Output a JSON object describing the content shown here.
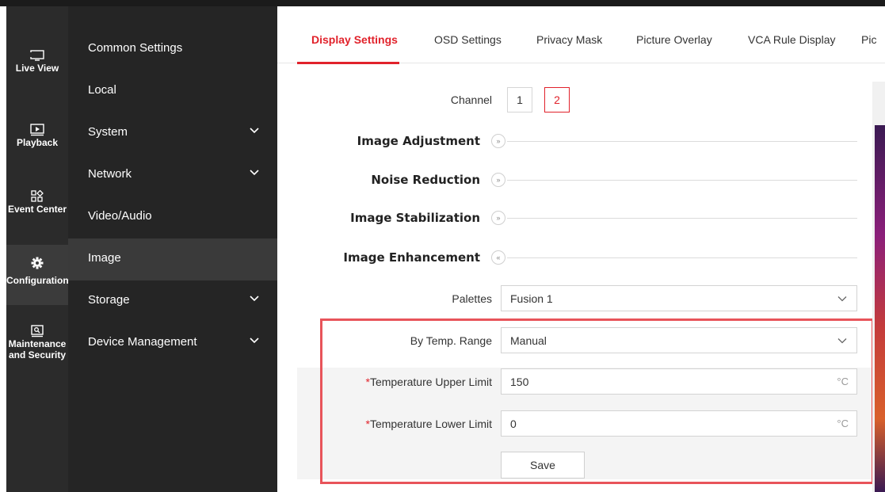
{
  "nav": {
    "items": [
      {
        "label": "Live View",
        "icon": "live-view-icon"
      },
      {
        "label": "Playback",
        "icon": "playback-icon"
      },
      {
        "label": "Event Center",
        "icon": "event-center-icon"
      },
      {
        "label": "Configuration",
        "icon": "gear-icon",
        "active": true
      },
      {
        "label": "Maintenance\nand Security",
        "icon": "maintenance-icon"
      }
    ]
  },
  "menu": {
    "items": [
      {
        "label": "Common Settings",
        "chevron": false
      },
      {
        "label": "Local",
        "chevron": false
      },
      {
        "label": "System",
        "chevron": true
      },
      {
        "label": "Network",
        "chevron": true
      },
      {
        "label": "Video/Audio",
        "chevron": false
      },
      {
        "label": "Image",
        "chevron": false,
        "active": true
      },
      {
        "label": "Storage",
        "chevron": true
      },
      {
        "label": "Device Management",
        "chevron": true
      }
    ]
  },
  "tabs": [
    {
      "label": "Display Settings",
      "active": true
    },
    {
      "label": "OSD Settings"
    },
    {
      "label": "Privacy Mask"
    },
    {
      "label": "Picture Overlay"
    },
    {
      "label": "VCA Rule Display"
    },
    {
      "label": "Pic"
    }
  ],
  "channel": {
    "label": "Channel",
    "options": [
      "1",
      "2"
    ],
    "selected": "2"
  },
  "sections": {
    "image_adjustment": "Image Adjustment",
    "noise_reduction": "Noise Reduction",
    "image_stabilization": "Image Stabilization",
    "image_enhancement": "Image Enhancement"
  },
  "form": {
    "palettes_label": "Palettes",
    "palettes_value": "Fusion 1",
    "temp_range_label": "By Temp. Range",
    "temp_range_value": "Manual",
    "required_mark": "*",
    "upper_label": "Temperature Upper Limit",
    "upper_value": "150",
    "lower_label": "Temperature Lower Limit",
    "lower_value": "0",
    "unit": "°C",
    "save_label": "Save"
  },
  "colors": {
    "accent": "#e1222b",
    "highlight_box": "#e8545a",
    "sidebar_bg": "#2b2b2b",
    "menu_bg": "#252525"
  }
}
